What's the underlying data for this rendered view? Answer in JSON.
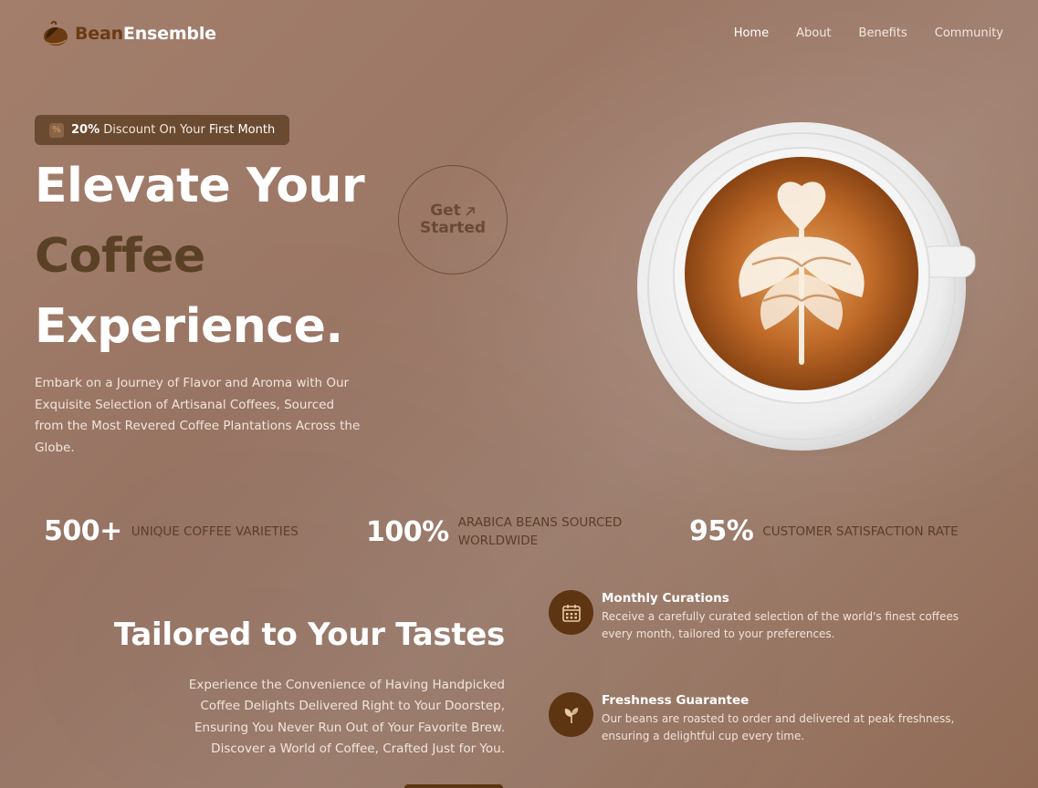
{
  "brand": {
    "part1": "Bean",
    "part2": "Ensemble"
  },
  "nav": {
    "items": [
      {
        "label": "Home"
      },
      {
        "label": "About"
      },
      {
        "label": "Benefits"
      },
      {
        "label": "Community"
      }
    ]
  },
  "hero": {
    "badge": {
      "pre": "20%",
      "mid": " Discount On Your ",
      "post": "First Month"
    },
    "headline": [
      "Elevate Your",
      "Coffee",
      "Experience."
    ],
    "cta": {
      "line1": "Get",
      "line2": "Started"
    },
    "description": "Embark on a Journey of Flavor and Aroma with Our Exquisite Selection of Artisanal Coffees, Sourced from the Most Revered Coffee Plantations Across the Globe."
  },
  "stats": [
    {
      "value": "500+",
      "label": "Unique Coffee Varieties"
    },
    {
      "value": "100%",
      "label_line1": "Arabica Beans Sourced",
      "label_line2": "Worldwide"
    },
    {
      "value": "95%",
      "label": "Customer Satisfaction Rate"
    }
  ],
  "tastes": {
    "title": "Tailored to Your Tastes",
    "body": [
      "Experience the Convenience of Having Handpicked",
      "Coffee Delights Delivered Right to Your Doorstep,",
      "Ensuring You Never Run Out of Your Favorite Brew.",
      "Discover a World of Coffee, Crafted Just for You."
    ]
  },
  "features": [
    {
      "icon": "calendar-icon",
      "title": "Monthly Curations",
      "desc_line1": "Receive a carefully curated selection of the world's finest coffees",
      "desc_line2": "every month, tailored to your preferences."
    },
    {
      "icon": "leaf-icon",
      "title": "Freshness Guarantee",
      "desc_line1": "Our beans are roasted to order and delivered at peak freshness,",
      "desc_line2": "ensuring a delightful cup every time."
    }
  ],
  "colors": {
    "accent_dark": "#5e3512",
    "headline_dark": "#5a4125",
    "stat_label": "#5a3e28"
  }
}
